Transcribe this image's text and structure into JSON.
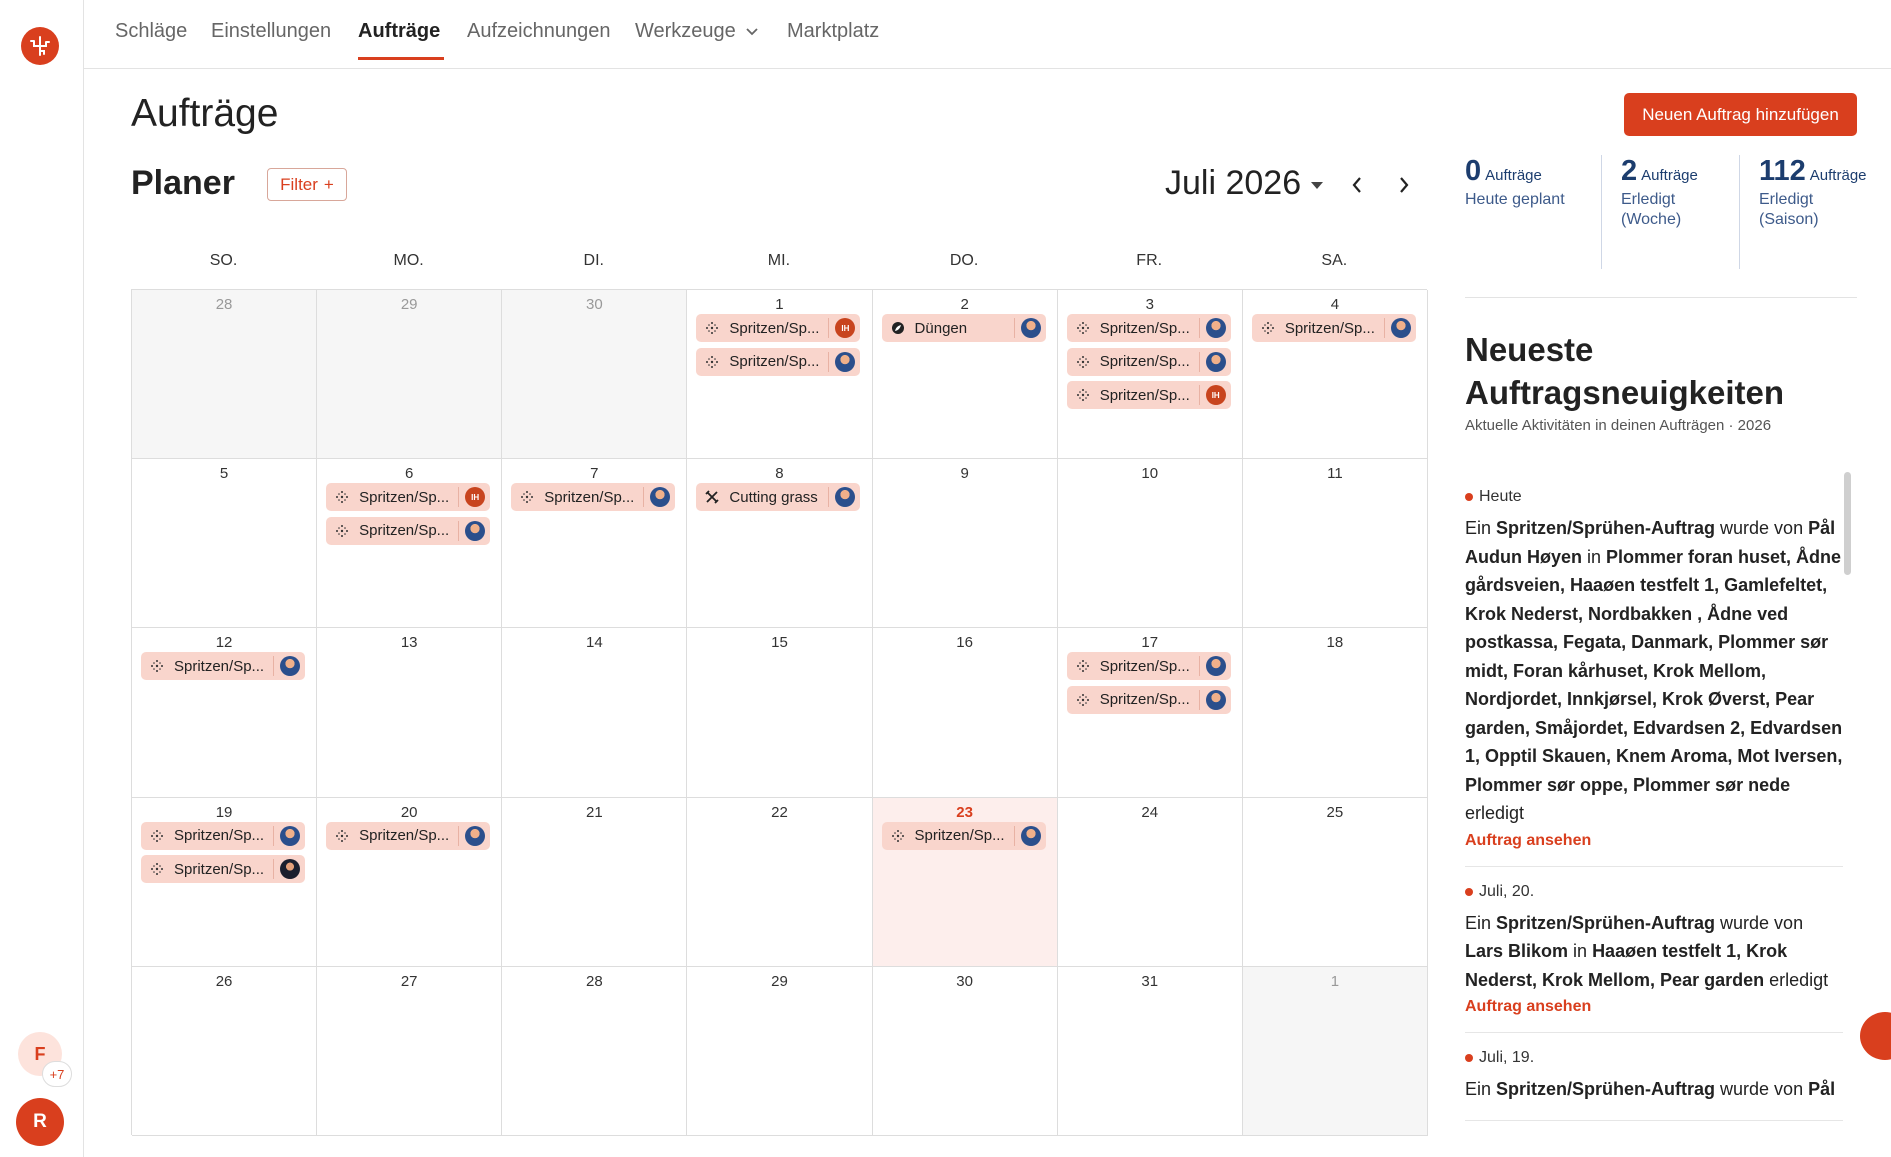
{
  "nav": {
    "items": [
      {
        "label": "Schläge",
        "active": false
      },
      {
        "label": "Einstellungen",
        "active": false
      },
      {
        "label": "Aufträge",
        "active": true
      },
      {
        "label": "Aufzeichnungen",
        "active": false
      },
      {
        "label": "Werkzeuge",
        "active": false
      },
      {
        "label": "Marktplatz",
        "active": false
      }
    ]
  },
  "page": {
    "title": "Aufträge",
    "new_button": "Neuen Auftrag hinzufügen"
  },
  "planner": {
    "title": "Planer",
    "filter_label": "Filter",
    "filter_plus": "+",
    "month": "Juli 2026",
    "weekdays": [
      "SO.",
      "MO.",
      "DI.",
      "MI.",
      "DO.",
      "FR.",
      "SA."
    ],
    "days": [
      {
        "n": "28",
        "other": true,
        "events": []
      },
      {
        "n": "29",
        "other": true,
        "events": []
      },
      {
        "n": "30",
        "other": true,
        "events": []
      },
      {
        "n": "1",
        "events": [
          {
            "label": "Spritzen/Sp...",
            "icon": "spray",
            "avatar": "ih"
          },
          {
            "label": "Spritzen/Sp...",
            "icon": "spray",
            "avatar": "photo"
          }
        ]
      },
      {
        "n": "2",
        "events": [
          {
            "label": "Düngen",
            "icon": "fertilize",
            "avatar": "photo"
          }
        ]
      },
      {
        "n": "3",
        "events": [
          {
            "label": "Spritzen/Sp...",
            "icon": "spray",
            "avatar": "photo"
          },
          {
            "label": "Spritzen/Sp...",
            "icon": "spray",
            "avatar": "photo"
          },
          {
            "label": "Spritzen/Sp...",
            "icon": "spray",
            "avatar": "ih"
          }
        ]
      },
      {
        "n": "4",
        "events": [
          {
            "label": "Spritzen/Sp...",
            "icon": "spray",
            "avatar": "photo"
          }
        ]
      },
      {
        "n": "5",
        "events": []
      },
      {
        "n": "6",
        "events": [
          {
            "label": "Spritzen/Sp...",
            "icon": "spray",
            "avatar": "ih"
          },
          {
            "label": "Spritzen/Sp...",
            "icon": "spray",
            "avatar": "photo"
          }
        ]
      },
      {
        "n": "7",
        "events": [
          {
            "label": "Spritzen/Sp...",
            "icon": "spray",
            "avatar": "photo"
          }
        ]
      },
      {
        "n": "8",
        "events": [
          {
            "label": "Cutting grass",
            "icon": "tools",
            "avatar": "photo"
          }
        ]
      },
      {
        "n": "9",
        "events": []
      },
      {
        "n": "10",
        "events": []
      },
      {
        "n": "11",
        "events": []
      },
      {
        "n": "12",
        "events": [
          {
            "label": "Spritzen/Sp...",
            "icon": "spray",
            "avatar": "photo"
          }
        ]
      },
      {
        "n": "13",
        "events": []
      },
      {
        "n": "14",
        "events": []
      },
      {
        "n": "15",
        "events": []
      },
      {
        "n": "16",
        "events": []
      },
      {
        "n": "17",
        "events": [
          {
            "label": "Spritzen/Sp...",
            "icon": "spray",
            "avatar": "photo"
          },
          {
            "label": "Spritzen/Sp...",
            "icon": "spray",
            "avatar": "photo"
          }
        ]
      },
      {
        "n": "18",
        "events": []
      },
      {
        "n": "19",
        "events": [
          {
            "label": "Spritzen/Sp...",
            "icon": "spray",
            "avatar": "photo"
          },
          {
            "label": "Spritzen/Sp...",
            "icon": "spray",
            "avatar": "dark"
          }
        ]
      },
      {
        "n": "20",
        "events": [
          {
            "label": "Spritzen/Sp...",
            "icon": "spray",
            "avatar": "photo"
          }
        ]
      },
      {
        "n": "21",
        "events": []
      },
      {
        "n": "22",
        "events": []
      },
      {
        "n": "23",
        "today": true,
        "events": [
          {
            "label": "Spritzen/Sp...",
            "icon": "spray",
            "avatar": "photo"
          }
        ]
      },
      {
        "n": "24",
        "events": []
      },
      {
        "n": "25",
        "events": []
      },
      {
        "n": "26",
        "events": []
      },
      {
        "n": "27",
        "events": []
      },
      {
        "n": "28",
        "events": []
      },
      {
        "n": "29",
        "events": []
      },
      {
        "n": "30",
        "events": []
      },
      {
        "n": "31",
        "events": []
      },
      {
        "n": "1",
        "other": true,
        "events": []
      }
    ],
    "avatar_initials": "IH"
  },
  "stats": [
    {
      "value": "0",
      "unit": "Aufträge",
      "label": "Heute geplant"
    },
    {
      "value": "2",
      "unit": "Aufträge",
      "label": "Erledigt (Woche)"
    },
    {
      "value": "112",
      "unit": "Aufträge",
      "label": "Erledigt (Saison)"
    }
  ],
  "news": {
    "title": "Neueste Auftragsneuigkeiten",
    "subtitle": "Aktuelle Aktivitäten in deinen Aufträgen · 2026",
    "link_label": "Auftrag ansehen",
    "items": [
      {
        "date": "Heute",
        "pre": "Ein ",
        "job": "Spritzen/Sprühen-Auftrag",
        "mid1": " wurde von ",
        "person": "Pål Audun Høyen",
        "mid2": " in ",
        "places": "Plommer foran huset, Ådne gårdsveien, Haaøen testfelt 1, Gamlefeltet, Krok Nederst, Nordbakken , Ådne ved postkassa, Fegata, Danmark, Plommer sør midt, Foran kårhuset, Krok Mellom, Nordjordet, Innkjørsel, Krok Øverst, Pear garden, Småjordet, Edvardsen 2, Edvardsen 1, Opptil Skauen, Knem Aroma, Mot Iversen, Plommer sør oppe, Plommer sør nede",
        "post": " erledigt"
      },
      {
        "date": "Juli, 20.",
        "pre": "Ein ",
        "job": "Spritzen/Sprühen-Auftrag",
        "mid1": " wurde von ",
        "person": "Lars Blikom",
        "mid2": " in ",
        "places": "Haaøen testfelt 1, Krok Nederst, Krok Mellom, Pear garden",
        "post": " erledigt"
      },
      {
        "date": "Juli, 19.",
        "pre": "Ein ",
        "job": "Spritzen/Sprühen-Auftrag",
        "mid1": " wurde von ",
        "person": "Pål",
        "mid2": "",
        "places": "",
        "post": ""
      }
    ]
  },
  "user": {
    "initial_f": "F",
    "more": "+7",
    "initial_r": "R"
  },
  "colors": {
    "accent": "#d93f1e",
    "event_bg": "#f9d5cc",
    "today_bg": "#fdeeec",
    "stat_blue": "#1c3d6e"
  }
}
